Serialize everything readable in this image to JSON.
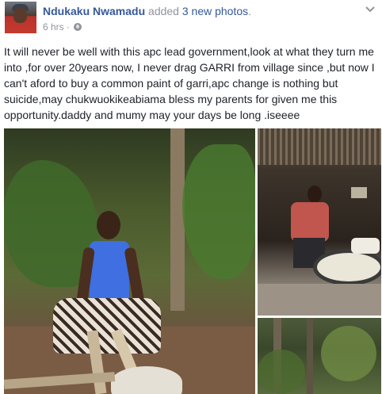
{
  "post": {
    "author": "Ndukaku Nwamadu",
    "action_prefix": "added",
    "action_count": "3 new photos",
    "action_suffix": ".",
    "time": "6 hrs",
    "time_separator": "·",
    "privacy_icon": "globe-icon",
    "menu_icon": "chevron-down-icon",
    "text": "It will never be well with this apc lead government,look at what they turn me into ,for over 20years now, I never drag GARRI from village since ,but now I can't aford to buy a common paint of garri,apc change is nothing but suicide,may chukwuokikeabiama bless my parents for given me this opportunity.daddy and mumy may your days be long .iseeee",
    "photos": [
      {
        "name": "photo-man-grating-cassava"
      },
      {
        "name": "photo-man-frying-garri"
      },
      {
        "name": "photo-bush-scene"
      }
    ]
  },
  "colors": {
    "link": "#365899",
    "meta": "#90949c",
    "text": "#1d2129"
  }
}
